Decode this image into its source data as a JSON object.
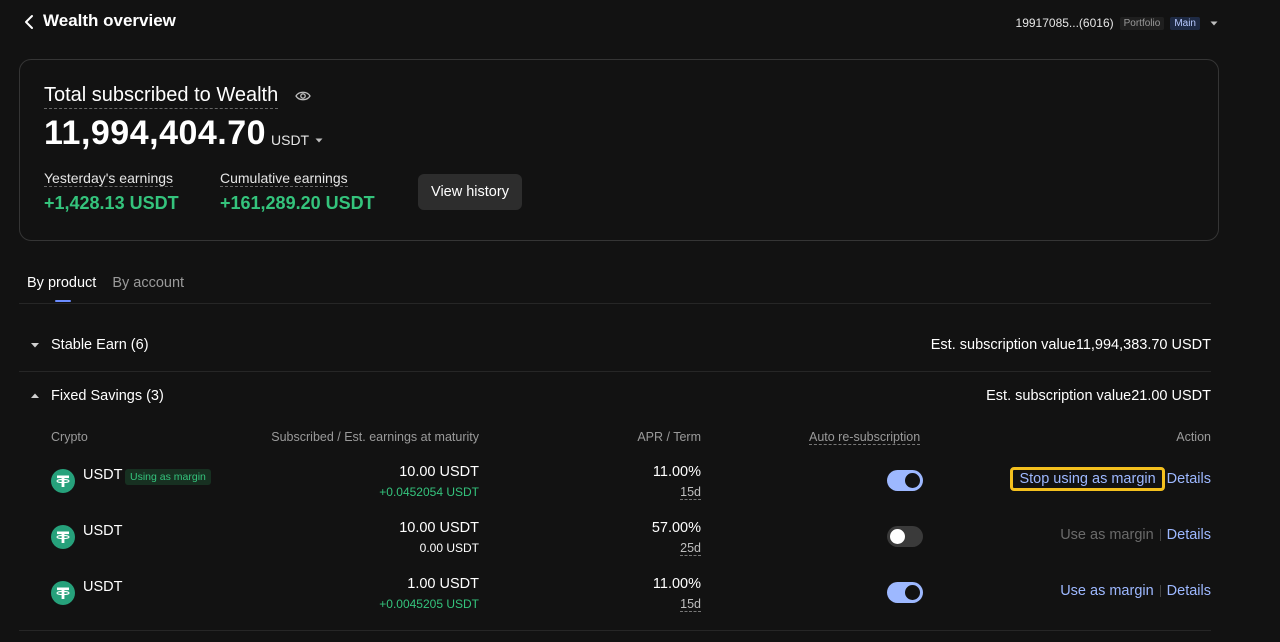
{
  "header": {
    "title": "Wealth overview",
    "account_number": "19917085...(6016)",
    "portfolio_tag": "Portfolio",
    "main_tag": "Main"
  },
  "summary": {
    "title": "Total subscribed to Wealth",
    "amount": "11,994,404.70",
    "currency": "USDT",
    "yesterday_label": "Yesterday's earnings",
    "yesterday_value": "+1,428.13 USDT",
    "cumulative_label": "Cumulative earnings",
    "cumulative_value": "+161,289.20 USDT",
    "view_history": "View history"
  },
  "tabs": [
    {
      "label": "By product",
      "active": true
    },
    {
      "label": "By account",
      "active": false
    }
  ],
  "groups": {
    "stable": {
      "name": "Stable Earn (6)",
      "value": "Est. subscription value11,994,383.70 USDT",
      "expanded": false
    },
    "fixed": {
      "name": "Fixed Savings (3)",
      "value": "Est. subscription value21.00 USDT",
      "expanded": true
    }
  },
  "table": {
    "headers": {
      "crypto": "Crypto",
      "subscribed": "Subscribed / Est. earnings at maturity",
      "apr": "APR / Term",
      "auto": "Auto re-subscription",
      "action": "Action"
    },
    "rows": [
      {
        "coin": "USDT",
        "badge": "Using as margin",
        "subscribed": "10.00 USDT",
        "earnings": "+0.0452054 USDT",
        "apr": "11.00%",
        "term": "15d",
        "auto_resub": true,
        "margin_action": "Stop using as margin",
        "details": "Details"
      },
      {
        "coin": "USDT",
        "badge": "",
        "subscribed": "10.00 USDT",
        "earnings": "0.00 USDT",
        "apr": "57.00%",
        "term": "25d",
        "auto_resub": false,
        "margin_action": "Use as margin",
        "details": "Details"
      },
      {
        "coin": "USDT",
        "badge": "",
        "subscribed": "1.00 USDT",
        "earnings": "+0.0045205 USDT",
        "apr": "11.00%",
        "term": "15d",
        "auto_resub": true,
        "margin_action": "Use as margin",
        "details": "Details"
      }
    ]
  },
  "colors": {
    "accent": "#9db8ff",
    "positive": "#34c37c",
    "highlight": "#f4c01e",
    "background": "#121212"
  }
}
